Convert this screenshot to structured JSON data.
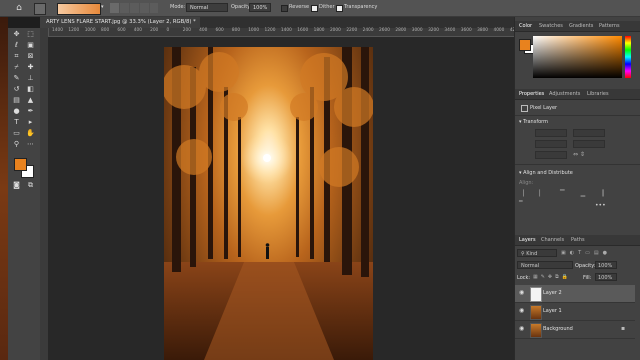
{
  "options_bar": {
    "mode_label": "Mode:",
    "mode_value": "Normal",
    "opacity_label": "Opacity:",
    "opacity_value": "100%",
    "reverse_label": "Reverse",
    "dither_label": "Dither",
    "transparency_label": "Transparency",
    "reverse_checked": false,
    "dither_checked": true,
    "transparency_checked": true
  },
  "document_tab": {
    "title": "ARTY LENS FLARE START.jpg @ 33.3% (Layer 2, RGB/8) *"
  },
  "ruler_ticks": [
    "1400",
    "1300",
    "1200",
    "1100",
    "1000",
    "900",
    "800",
    "700",
    "600",
    "500",
    "400",
    "300",
    "200",
    "100",
    "0",
    "100",
    "200",
    "300",
    "400",
    "500",
    "600",
    "700",
    "800",
    "900",
    "1000",
    "1100",
    "1200",
    "1300",
    "1400",
    "1500",
    "1600",
    "1700",
    "1800",
    "1900",
    "2000",
    "2100",
    "2200",
    "2300",
    "2400",
    "2500",
    "2600",
    "2700",
    "2800",
    "2900",
    "3000",
    "3100",
    "3200",
    "3300",
    "3400",
    "3500",
    "3600",
    "3700",
    "3800",
    "3900",
    "4000",
    "4100",
    "4200"
  ],
  "colors": {
    "foreground": "#e8821e",
    "background": "#ffffff",
    "accent_flare": "#fffaf0",
    "forest_orange": "#d87a22"
  },
  "color_panel": {
    "tabs": [
      "Color",
      "Swatches",
      "Gradients",
      "Patterns"
    ],
    "active_tab": "Color"
  },
  "properties_panel": {
    "tabs": [
      "Properties",
      "Adjustments",
      "Libraries"
    ],
    "active_tab": "Properties",
    "layer_kind": "Pixel Layer",
    "transform_label": "Transform",
    "align_label": "Align and Distribute",
    "align_sub": "Align:"
  },
  "layers_panel": {
    "tabs": [
      "Layers",
      "Channels",
      "Paths"
    ],
    "active_tab": "Layers",
    "filter_label": "Kind",
    "blend_mode": "Normal",
    "opacity_label": "Opacity:",
    "opacity_value": "100%",
    "lock_label": "Lock:",
    "fill_label": "Fill:",
    "fill_value": "100%",
    "layers": [
      {
        "name": "Layer 2",
        "selected": true,
        "thumb": "white"
      },
      {
        "name": "Layer 1",
        "selected": false,
        "thumb": "forest"
      },
      {
        "name": "Background",
        "selected": false,
        "thumb": "forest",
        "locked": true
      }
    ]
  },
  "tools": [
    "move-tool-icon",
    "marquee-tool-icon",
    "lasso-tool-icon",
    "object-select-tool-icon",
    "crop-tool-icon",
    "eyedropper-tool-icon",
    "healing-brush-icon",
    "brush-tool-icon",
    "clone-stamp-icon",
    "history-brush-icon",
    "eraser-tool-icon",
    "gradient-tool-icon",
    "blur-tool-icon",
    "dodge-tool-icon",
    "pen-tool-icon",
    "type-tool-icon",
    "path-select-icon",
    "shape-tool-icon",
    "hand-tool-icon",
    "zoom-tool-icon",
    "more-tools-icon"
  ]
}
